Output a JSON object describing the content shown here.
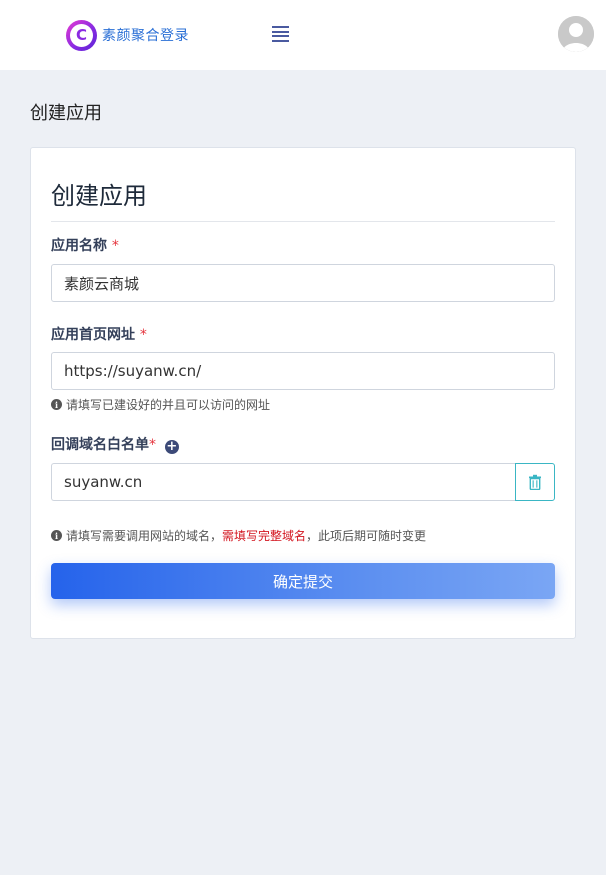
{
  "header": {
    "brand_logo_letter": "C",
    "brand_name": "素颜聚合登录",
    "menu_icon": "hamburger-icon",
    "avatar_icon": "user-avatar-icon"
  },
  "page": {
    "title": "创建应用"
  },
  "form": {
    "title": "创建应用",
    "app_name": {
      "label": "应用名称",
      "required_mark": "*",
      "value": "素颜云商城"
    },
    "homepage_url": {
      "label": "应用首页网址",
      "required_mark": "*",
      "value": "https://suyanw.cn/",
      "hint": "请填写已建设好的并且可以访问的网址"
    },
    "callback_whitelist": {
      "label": "回调域名白名单",
      "required_mark": "*",
      "add_icon": "plus-circle-icon",
      "value": "suyanw.cn",
      "delete_icon": "trash-icon",
      "hint_prefix": "请填写需要调用网站的域名，",
      "hint_highlight": "需填写完整域名",
      "hint_suffix": "，此项后期可随时变更"
    },
    "submit_label": "确定提交"
  },
  "colors": {
    "accent": "#2563eb",
    "required": "#e5343d",
    "hint_highlight": "#d3151f",
    "delete_border": "#3ab6c4",
    "background": "#edf0f5"
  }
}
